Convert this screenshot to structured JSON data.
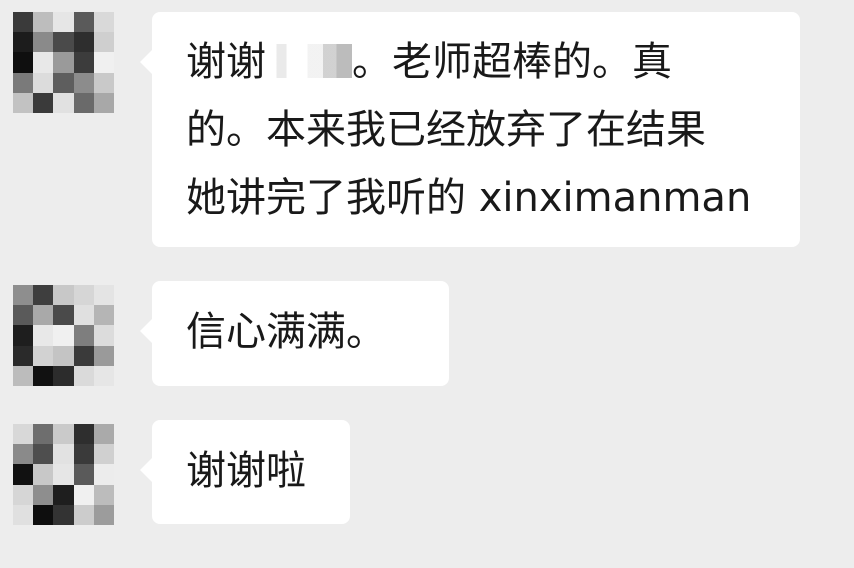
{
  "messages": [
    {
      "lines": [
        {
          "before": "谢谢",
          "redacted": true,
          "after": "。老师超棒的。真"
        },
        {
          "text": "的。本来我已经放弃了在结果"
        },
        {
          "text": "她讲完了我听的 xinximanman"
        }
      ]
    },
    {
      "lines": [
        {
          "text": "信心满满。"
        }
      ]
    },
    {
      "lines": [
        {
          "text": "谢谢啦"
        }
      ]
    }
  ],
  "colors": {
    "background": "#ededed",
    "bubble": "#ffffff",
    "text": "#191919"
  },
  "avatar_mosaics": [
    [
      "#3a3a3a",
      "#bdbdbd",
      "#e6e6e6",
      "#5a5a5a",
      "#d9d9d9",
      "#1c1c1c",
      "#8a8a8a",
      "#4a4a4a",
      "#2e2e2e",
      "#cfcfcf",
      "#0f0f0f",
      "#e8e8e8",
      "#9a9a9a",
      "#3c3c3c",
      "#f0f0f0",
      "#7a7a7a",
      "#dcdcdc",
      "#5e5e5e",
      "#8c8c8c",
      "#c9c9c9",
      "#c2c2c2",
      "#3a3a3a",
      "#e1e1e1",
      "#6a6a6a",
      "#a8a8a8"
    ],
    [
      "#8e8e8e",
      "#3e3e3e",
      "#c8c8c8",
      "#d6d6d6",
      "#e4e4e4",
      "#5a5a5a",
      "#a9a9a9",
      "#4a4a4a",
      "#e0e0e0",
      "#b5b5b5",
      "#1e1e1e",
      "#e8e8e8",
      "#f0f0f0",
      "#7e7e7e",
      "#dcdcdc",
      "#2a2a2a",
      "#d2d2d2",
      "#c4c4c4",
      "#3a3a3a",
      "#9a9a9a",
      "#bcbcbc",
      "#111111",
      "#2c2c2c",
      "#dadada",
      "#e6e6e6"
    ],
    [
      "#d8d8d8",
      "#6e6e6e",
      "#cacaca",
      "#2e2e2e",
      "#aaaaaa",
      "#8a8a8a",
      "#4e4e4e",
      "#e2e2e2",
      "#3a3a3a",
      "#d0d0d0",
      "#111111",
      "#c8c8c8",
      "#e6e6e6",
      "#5a5a5a",
      "#ececec",
      "#d6d6d6",
      "#8e8e8e",
      "#1e1e1e",
      "#f0f0f0",
      "#bcbcbc",
      "#e0e0e0",
      "#0e0e0e",
      "#333333",
      "#cccccc",
      "#9c9c9c"
    ]
  ]
}
